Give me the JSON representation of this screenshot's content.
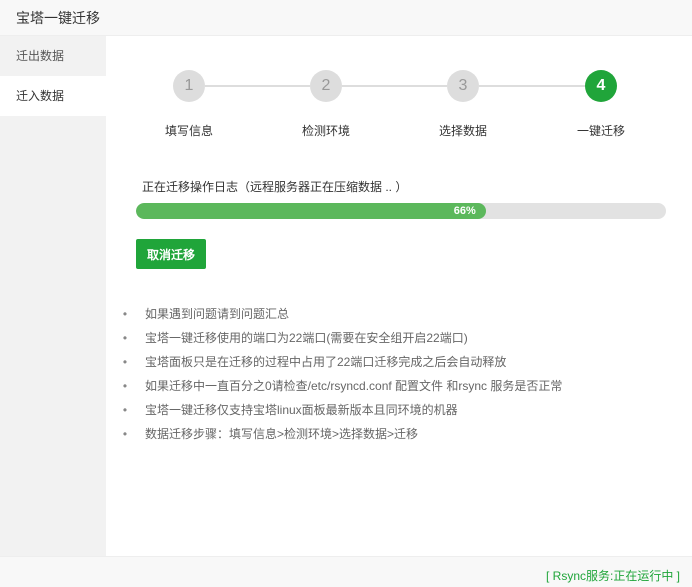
{
  "window": {
    "title": "宝塔一键迁移"
  },
  "sidebar": {
    "items": [
      {
        "label": "迁出数据",
        "active": false
      },
      {
        "label": "迁入数据",
        "active": true
      }
    ]
  },
  "steps": [
    {
      "number": "1",
      "label": "填写信息",
      "active": false
    },
    {
      "number": "2",
      "label": "检测环境",
      "active": false
    },
    {
      "number": "3",
      "label": "选择数据",
      "active": false
    },
    {
      "number": "4",
      "label": "一键迁移",
      "active": true
    }
  ],
  "progress": {
    "status_text": "正在迁移操作日志（远程服务器正在压缩数据 .. ）",
    "percent": 66,
    "percent_label": "66%"
  },
  "actions": {
    "cancel_label": "取消迁移"
  },
  "tips": [
    "如果遇到问题请到问题汇总",
    "宝塔一键迁移使用的端口为22端口(需要在安全组开启22端口)",
    "宝塔面板只是在迁移的过程中占用了22端口迁移完成之后会自动释放",
    "如果迁移中一直百分之0请检查/etc/rsyncd.conf 配置文件 和rsync 服务是否正常",
    "宝塔一键迁移仅支持宝塔linux面板最新版本且同环境的机器",
    "数据迁移步骤：填写信息>检测环境>选择数据>迁移"
  ],
  "footer": {
    "rsync_status": "[ Rsync服务:正在运行中 ]"
  },
  "colors": {
    "accent": "#20a53a",
    "progress": "#5cb85c",
    "inactive_step": "#dddddd"
  }
}
